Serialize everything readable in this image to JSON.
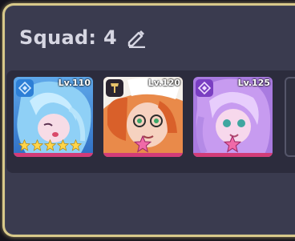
{
  "squad": {
    "title": "Squad: 4",
    "edit_icon": "pencil-icon"
  },
  "characters": [
    {
      "level": "Lv.110",
      "class_icon": "mage-class-icon",
      "class_color": "#2d7fd6",
      "stars": 5,
      "star_type": "gold"
    },
    {
      "level": "Lv.120",
      "class_icon": "warrior-class-icon",
      "class_color": "#2a2430",
      "stars": 1,
      "star_type": "pink"
    },
    {
      "level": "Lv.125",
      "class_icon": "mage-class-icon",
      "class_color": "#7a3fc2",
      "stars": 1,
      "star_type": "pink"
    }
  ],
  "colors": {
    "frame": "#d8c98a",
    "panel": "#3a3b4f",
    "rarity_bar": "#d23c78"
  }
}
